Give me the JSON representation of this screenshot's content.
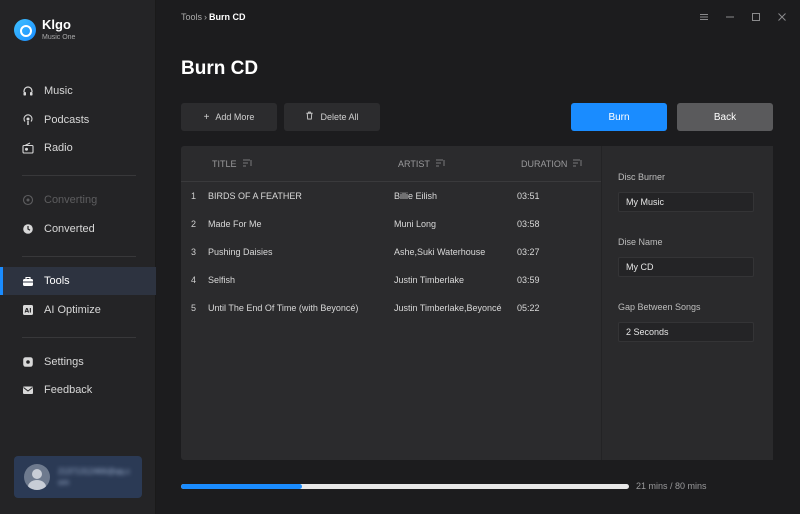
{
  "app": {
    "name": "Klgo",
    "subtitle": "Music One"
  },
  "sidebar": {
    "items": [
      {
        "label": "Music",
        "icon": "headphones-icon"
      },
      {
        "label": "Podcasts",
        "icon": "podcast-icon"
      },
      {
        "label": "Radio",
        "icon": "radio-icon"
      },
      {
        "label": "Converting",
        "icon": "converting-icon"
      },
      {
        "label": "Converted",
        "icon": "clock-icon"
      },
      {
        "label": "Tools",
        "icon": "toolbox-icon"
      },
      {
        "label": "AI Optimize",
        "icon": "ai-icon"
      },
      {
        "label": "Settings",
        "icon": "gear-icon"
      },
      {
        "label": "Feedback",
        "icon": "mail-icon"
      }
    ],
    "user": {
      "email": "21371312466@qq.com"
    }
  },
  "breadcrumb": {
    "parent": "Tools",
    "separator": "›",
    "current": "Burn CD"
  },
  "page": {
    "title": "Burn CD"
  },
  "toolbar": {
    "add_more": "Add More",
    "delete_all": "Delete All",
    "burn": "Burn",
    "back": "Back"
  },
  "table": {
    "headers": {
      "title": "TITLE",
      "artist": "ARTIST",
      "duration": "DURATION"
    },
    "rows": [
      {
        "num": "1",
        "title": "BIRDS OF A FEATHER",
        "artist": "Billie Eilish",
        "duration": "03:51"
      },
      {
        "num": "2",
        "title": "Made For Me",
        "artist": "Muni Long",
        "duration": "03:58"
      },
      {
        "num": "3",
        "title": "Pushing Daisies",
        "artist": "Ashe,Suki Waterhouse",
        "duration": "03:27"
      },
      {
        "num": "4",
        "title": "Selfish",
        "artist": "Justin Timberlake",
        "duration": "03:59"
      },
      {
        "num": "5",
        "title": "Until The End Of Time (with Beyoncé)",
        "artist": "Justin Timberlake,Beyoncé",
        "duration": "05:22"
      }
    ]
  },
  "settings": {
    "disc_burner_label": "Disc Burner",
    "disc_burner_value": "My Music",
    "disc_name_label": "Dise Name",
    "disc_name_value": "My CD",
    "gap_label": "Gap Between Songs",
    "gap_value": "2 Seconds"
  },
  "progress": {
    "fraction": 0.27,
    "text": "21 mins / 80 mins"
  },
  "colors": {
    "accent": "#1a8cff"
  }
}
